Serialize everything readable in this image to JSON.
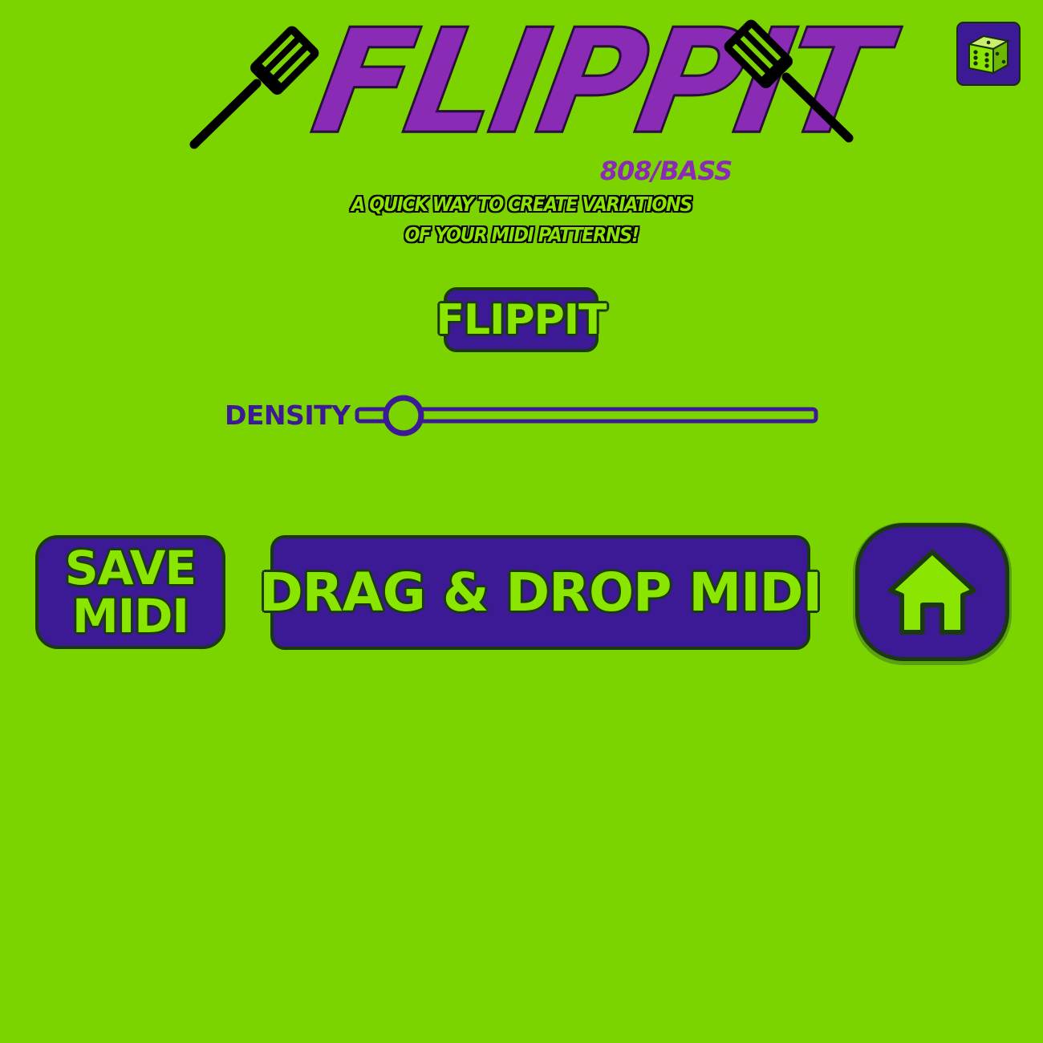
{
  "header": {
    "title": "FLIPPIT",
    "subtitle": "808/BASS",
    "tagline_line1": "A QUICK WAY TO CREATE VARIATIONS",
    "tagline_line2": "OF YOUR MIDI PATTERNS!"
  },
  "icons": {
    "left": "spatula-icon",
    "right": "spatula-icon",
    "dice": "dice-icon",
    "home": "home-icon"
  },
  "controls": {
    "flippit_label": "FLIPPIT",
    "density_label": "DENSITY",
    "density_value": 0.05
  },
  "actions": {
    "save_line1": "SAVE",
    "save_line2": "MIDI",
    "drag_drop_label": "DRAG & DROP MIDI"
  },
  "colors": {
    "background": "#7bd400",
    "button_fill": "#3d1a95",
    "button_text": "#8ae600",
    "title": "#8a2bb5"
  }
}
